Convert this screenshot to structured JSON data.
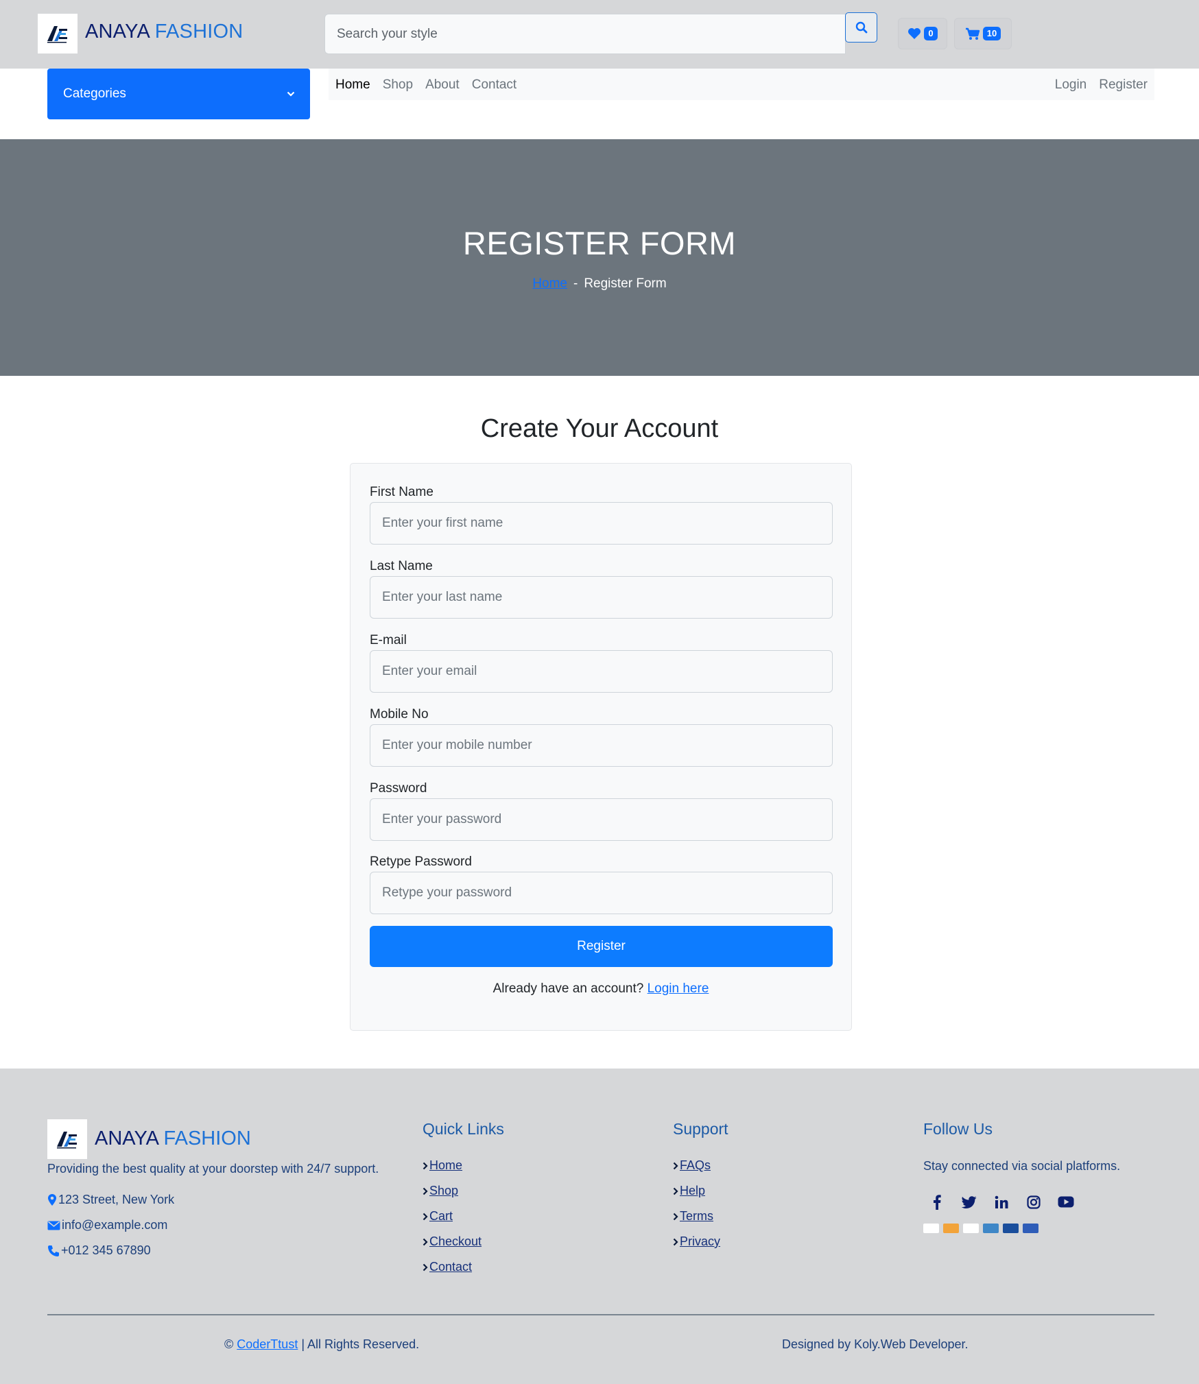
{
  "header": {
    "brand_part1": "ANAYA",
    "brand_part2": "FASHION",
    "logo_icon": "anaya-logo-icon",
    "search_placeholder": "Search your style",
    "search_icon": "search-icon",
    "wishlist_icon": "heart-icon",
    "wishlist_count": "0",
    "cart_icon": "cart-icon",
    "cart_count": "10"
  },
  "nav": {
    "categories_label": "Categories",
    "categories_icon": "chevron-down-icon",
    "links": [
      "Home",
      "Shop",
      "About",
      "Contact"
    ],
    "active_link": "Home",
    "auth_links": [
      "Login",
      "Register"
    ]
  },
  "hero": {
    "title": "REGISTER FORM",
    "breadcrumb_home": "Home",
    "breadcrumb_separator": "-",
    "breadcrumb_current": "Register Form"
  },
  "form": {
    "heading": "Create Your Account",
    "fields": [
      {
        "label": "First Name",
        "placeholder": "Enter your first name"
      },
      {
        "label": "Last Name",
        "placeholder": "Enter your last name"
      },
      {
        "label": "E-mail",
        "placeholder": "Enter your email"
      },
      {
        "label": "Mobile No",
        "placeholder": "Enter your mobile number"
      },
      {
        "label": "Password",
        "placeholder": "Enter your password"
      },
      {
        "label": "Retype Password",
        "placeholder": "Retype your password"
      }
    ],
    "submit_label": "Register",
    "login_prompt": "Already have an account?",
    "login_link": "Login here"
  },
  "footer": {
    "brand_part1": "ANAYA",
    "brand_part2": "FASHION",
    "description": "Providing the best quality at your doorstep with 24/7 support.",
    "address": "123 Street, New York",
    "email": "info@example.com",
    "phone": "+012 345 67890",
    "quick_links_title": "Quick Links",
    "quick_links": [
      "Home",
      "Shop",
      "Cart",
      "Checkout",
      "Contact"
    ],
    "support_title": "Support",
    "support_links": [
      "FAQs",
      "Help",
      "Terms",
      "Privacy"
    ],
    "follow_title": "Follow Us",
    "follow_text": "Stay connected via social platforms.",
    "social_icons": [
      "facebook-icon",
      "twitter-icon",
      "linkedin-icon",
      "instagram-icon",
      "youtube-icon"
    ],
    "payment_icons": [
      "visa-icon",
      "mastercard-icon",
      "paypal-icon",
      "amex-icon",
      "visa-electron-icon",
      "maestro-icon"
    ],
    "copyright_symbol": "©",
    "copyright_link": "CoderTtust",
    "copyright_rest": "| All Rights Reserved.",
    "designed_by": "Designed by Koly.Web Developer."
  },
  "colors": {
    "primary": "#0d6efd",
    "topbar_bg": "#d6d7d9",
    "hero_bg": "#6c757d",
    "brand_dark": "#0c1f6e",
    "brand_light": "#1e72d6"
  }
}
